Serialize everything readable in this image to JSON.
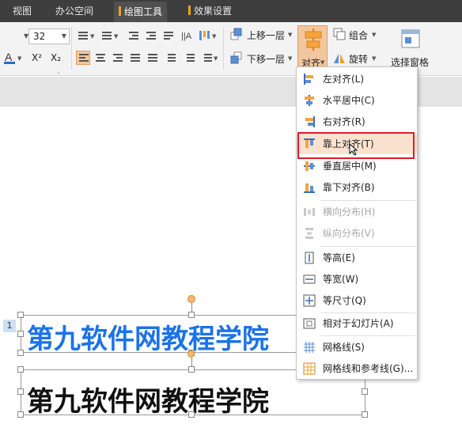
{
  "tabs": [
    {
      "label": "视图",
      "active": false
    },
    {
      "label": "办公空间",
      "active": false
    },
    {
      "label": "绘图工具",
      "active": true
    },
    {
      "label": "效果设置",
      "active": false
    }
  ],
  "ribbon": {
    "font_size": "32",
    "move_up_label": "上移一层",
    "move_down_label": "下移一层",
    "align_label": "对齐",
    "group_label": "组合",
    "rotate_label": "旋转",
    "selection_pane_label": "选择窗格",
    "superscript": "X²",
    "subscript": "X₂"
  },
  "menu": {
    "items": [
      {
        "label": "左对齐(L)",
        "icon": "align-left-icon",
        "disabled": false
      },
      {
        "label": "水平居中(C)",
        "icon": "align-center-horizontal-icon",
        "disabled": false
      },
      {
        "label": "右对齐(R)",
        "icon": "align-right-icon",
        "disabled": false
      },
      {
        "label": "靠上对齐(T)",
        "icon": "align-top-icon",
        "disabled": false,
        "highlighted": true
      },
      {
        "label": "垂直居中(M)",
        "icon": "align-middle-vertical-icon",
        "disabled": false
      },
      {
        "label": "靠下对齐(B)",
        "icon": "align-bottom-icon",
        "disabled": false
      },
      {
        "label": "横向分布(H)",
        "icon": "distribute-horizontal-icon",
        "disabled": true
      },
      {
        "label": "纵向分布(V)",
        "icon": "distribute-vertical-icon",
        "disabled": true
      },
      {
        "label": "等高(E)",
        "icon": "same-height-icon",
        "disabled": false
      },
      {
        "label": "等宽(W)",
        "icon": "same-width-icon",
        "disabled": false
      },
      {
        "label": "等尺寸(Q)",
        "icon": "same-size-icon",
        "disabled": false
      },
      {
        "label": "相对于幻灯片(A)",
        "icon": "relative-to-slide-icon",
        "disabled": false
      },
      {
        "label": "网格线(S)",
        "icon": "gridlines-icon",
        "disabled": false
      },
      {
        "label": "网格线和参考线(G)...",
        "icon": "gridlines-guides-icon",
        "disabled": false
      }
    ]
  },
  "slide": {
    "number": "1",
    "text_blue": "第九软件网教程学院",
    "text_black": "第九软件网教程学院"
  },
  "colors": {
    "accent": "#f0a020",
    "blue_text": "#1a73e8",
    "highlight": "#fbe2cf",
    "red_box": "#e0192a"
  }
}
